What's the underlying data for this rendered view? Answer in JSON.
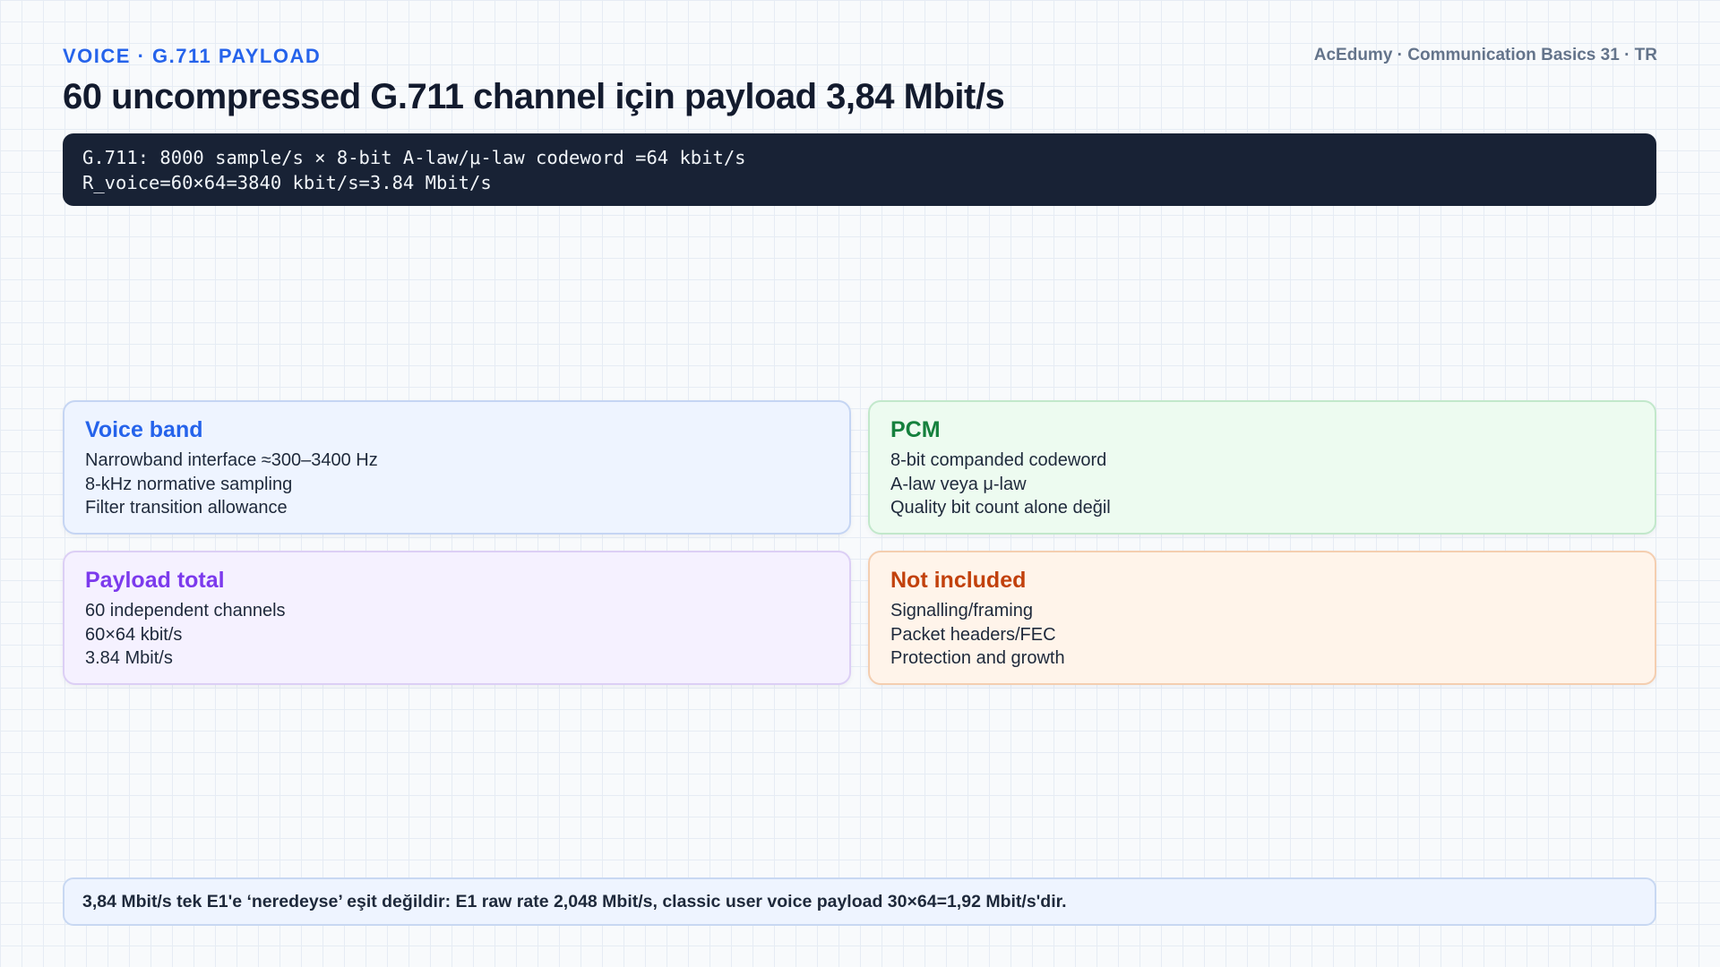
{
  "header": {
    "eyebrow": "VOICE · G.711 PAYLOAD",
    "brand": "AcEdumy · Communication Basics 31 · TR",
    "title": "60 uncompressed G.711 channel için payload 3,84 Mbit/s"
  },
  "formula": {
    "line1": "G.711: 8000 sample/s × 8-bit A-law/μ-law codeword =64 kbit/s",
    "line2": "R_voice=60×64=3840 kbit/s=3.84 Mbit/s"
  },
  "cards": {
    "voice_band": {
      "title": "Voice band",
      "items": [
        "Narrowband interface ≈300–3400 Hz",
        "8-kHz normative sampling",
        "Filter transition allowance"
      ],
      "accent": "#2563eb"
    },
    "pcm": {
      "title": "PCM",
      "items": [
        "8-bit companded codeword",
        "A-law veya μ-law",
        "Quality bit count alone değil"
      ],
      "accent": "#15803d"
    },
    "payload_total": {
      "title": "Payload total",
      "items": [
        "60 independent channels",
        "60×64 kbit/s",
        "3.84 Mbit/s"
      ],
      "accent": "#7c3aed"
    },
    "not_included": {
      "title": "Not included",
      "items": [
        "Signalling/framing",
        "Packet headers/FEC",
        "Protection and growth"
      ],
      "accent": "#c2410c"
    }
  },
  "footer_note": "3,84 Mbit/s tek E1'e ‘neredeyse’ eşit değildir: E1 raw rate 2,048 Mbit/s, classic user voice payload 30×64=1,92 Mbit/s'dir."
}
